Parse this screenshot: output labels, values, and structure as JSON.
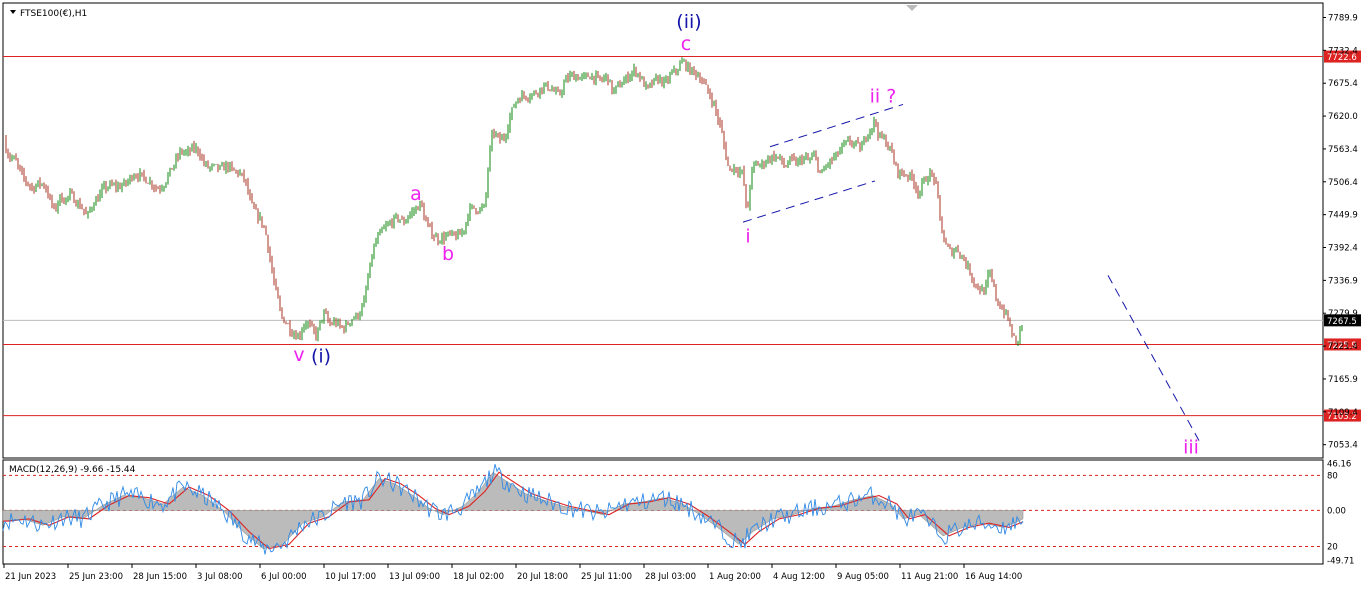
{
  "chart_data": {
    "type": "candlestick",
    "symbol_label": "FTSE100(€),H1",
    "main_panel": {
      "ylim": [
        7030,
        7815
      ],
      "y_ticks": [
        "7789.9",
        "7732.4",
        "7675.4",
        "7620.0",
        "7563.4",
        "7506.4",
        "7449.9",
        "7392.4",
        "7336.9",
        "7279.9",
        "7221.4",
        "7165.9",
        "7109.4",
        "7053.4"
      ],
      "price_series": [
        [
          0,
          7580
        ],
        [
          6,
          7550
        ],
        [
          12,
          7545
        ],
        [
          18,
          7520
        ],
        [
          24,
          7505
        ],
        [
          30,
          7495
        ],
        [
          36,
          7505
        ],
        [
          42,
          7500
        ],
        [
          48,
          7470
        ],
        [
          52,
          7455
        ],
        [
          56,
          7480
        ],
        [
          62,
          7475
        ],
        [
          68,
          7485
        ],
        [
          74,
          7470
        ],
        [
          80,
          7460
        ],
        [
          84,
          7445
        ],
        [
          90,
          7470
        ],
        [
          96,
          7480
        ],
        [
          100,
          7495
        ],
        [
          108,
          7500
        ],
        [
          116,
          7498
        ],
        [
          124,
          7505
        ],
        [
          130,
          7520
        ],
        [
          136,
          7518
        ],
        [
          142,
          7512
        ],
        [
          148,
          7505
        ],
        [
          154,
          7495
        ],
        [
          160,
          7500
        ],
        [
          166,
          7520
        ],
        [
          172,
          7540
        ],
        [
          178,
          7560
        ],
        [
          184,
          7555
        ],
        [
          190,
          7565
        ],
        [
          196,
          7560
        ],
        [
          200,
          7540
        ],
        [
          206,
          7530
        ],
        [
          212,
          7532
        ],
        [
          218,
          7528
        ],
        [
          224,
          7535
        ],
        [
          230,
          7525
        ],
        [
          236,
          7522
        ],
        [
          242,
          7510
        ],
        [
          246,
          7480
        ],
        [
          250,
          7460
        ],
        [
          256,
          7445
        ],
        [
          262,
          7425
        ],
        [
          266,
          7385
        ],
        [
          270,
          7340
        ],
        [
          274,
          7310
        ],
        [
          278,
          7275
        ],
        [
          284,
          7262
        ],
        [
          290,
          7245
        ],
        [
          296,
          7240
        ],
        [
          302,
          7265
        ],
        [
          308,
          7255
        ],
        [
          314,
          7240
        ],
        [
          318,
          7270
        ],
        [
          322,
          7280
        ],
        [
          326,
          7260
        ],
        [
          332,
          7265
        ],
        [
          338,
          7255
        ],
        [
          342,
          7255
        ],
        [
          348,
          7270
        ],
        [
          354,
          7275
        ],
        [
          360,
          7290
        ],
        [
          364,
          7330
        ],
        [
          368,
          7370
        ],
        [
          372,
          7400
        ],
        [
          378,
          7420
        ],
        [
          384,
          7430
        ],
        [
          390,
          7440
        ],
        [
          396,
          7445
        ],
        [
          400,
          7435
        ],
        [
          406,
          7450
        ],
        [
          410,
          7455
        ],
        [
          414,
          7462
        ],
        [
          418,
          7470
        ],
        [
          422,
          7440
        ],
        [
          428,
          7420
        ],
        [
          434,
          7408
        ],
        [
          440,
          7410
        ],
        [
          446,
          7415
        ],
        [
          452,
          7412
        ],
        [
          458,
          7416
        ],
        [
          462,
          7430
        ],
        [
          466,
          7458
        ],
        [
          470,
          7462
        ],
        [
          476,
          7458
        ],
        [
          482,
          7463
        ],
        [
          486,
          7550
        ],
        [
          490,
          7595
        ],
        [
          496,
          7578
        ],
        [
          502,
          7585
        ],
        [
          508,
          7625
        ],
        [
          514,
          7650
        ],
        [
          520,
          7655
        ],
        [
          526,
          7655
        ],
        [
          532,
          7660
        ],
        [
          538,
          7668
        ],
        [
          544,
          7672
        ],
        [
          550,
          7664
        ],
        [
          556,
          7655
        ],
        [
          562,
          7680
        ],
        [
          568,
          7690
        ],
        [
          574,
          7688
        ],
        [
          580,
          7685
        ],
        [
          586,
          7690
        ],
        [
          592,
          7686
        ],
        [
          598,
          7681
        ],
        [
          604,
          7690
        ],
        [
          610,
          7660
        ],
        [
          614,
          7670
        ],
        [
          620,
          7678
        ],
        [
          626,
          7690
        ],
        [
          632,
          7700
        ],
        [
          638,
          7685
        ],
        [
          644,
          7665
        ],
        [
          650,
          7678
        ],
        [
          656,
          7685
        ],
        [
          662,
          7675
        ],
        [
          668,
          7692
        ],
        [
          674,
          7700
        ],
        [
          680,
          7715
        ],
        [
          686,
          7700
        ],
        [
          692,
          7695
        ],
        [
          698,
          7685
        ],
        [
          704,
          7665
        ],
        [
          710,
          7645
        ],
        [
          714,
          7620
        ],
        [
          718,
          7598
        ],
        [
          722,
          7560
        ],
        [
          726,
          7525
        ],
        [
          730,
          7532
        ],
        [
          736,
          7526
        ],
        [
          740,
          7520
        ],
        [
          744,
          7445
        ],
        [
          748,
          7520
        ],
        [
          752,
          7538
        ],
        [
          758,
          7535
        ],
        [
          764,
          7545
        ],
        [
          770,
          7550
        ],
        [
          776,
          7548
        ],
        [
          782,
          7532
        ],
        [
          788,
          7545
        ],
        [
          794,
          7538
        ],
        [
          800,
          7548
        ],
        [
          806,
          7543
        ],
        [
          812,
          7552
        ],
        [
          818,
          7515
        ],
        [
          822,
          7532
        ],
        [
          828,
          7543
        ],
        [
          834,
          7553
        ],
        [
          840,
          7568
        ],
        [
          846,
          7576
        ],
        [
          852,
          7572
        ],
        [
          858,
          7563
        ],
        [
          864,
          7590
        ],
        [
          868,
          7600
        ],
        [
          872,
          7612
        ],
        [
          876,
          7585
        ],
        [
          882,
          7578
        ],
        [
          888,
          7560
        ],
        [
          894,
          7525
        ],
        [
          900,
          7520
        ],
        [
          906,
          7518
        ],
        [
          910,
          7510
        ],
        [
          916,
          7485
        ],
        [
          920,
          7505
        ],
        [
          924,
          7515
        ],
        [
          930,
          7520
        ],
        [
          934,
          7490
        ],
        [
          938,
          7430
        ],
        [
          942,
          7398
        ],
        [
          948,
          7385
        ],
        [
          954,
          7392
        ],
        [
          960,
          7375
        ],
        [
          966,
          7355
        ],
        [
          972,
          7330
        ],
        [
          978,
          7320
        ],
        [
          982,
          7318
        ],
        [
          986,
          7350
        ],
        [
          990,
          7330
        ],
        [
          994,
          7300
        ],
        [
          998,
          7290
        ],
        [
          1004,
          7275
        ],
        [
          1008,
          7250
        ],
        [
          1012,
          7232
        ],
        [
          1014,
          7220
        ],
        [
          1016,
          7250
        ],
        [
          1020,
          7262
        ]
      ],
      "horizontal_levels": [
        {
          "value": 7722.6,
          "label": "7722.6",
          "color": "#dd2222"
        },
        {
          "value": 7225.9,
          "label": "7225.9",
          "color": "#dd2222"
        },
        {
          "value": 7103.2,
          "label": "7103.2",
          "color": "#dd2222"
        },
        {
          "value": 7267.5,
          "label": "7267.5",
          "color": "#bbbbbb"
        }
      ],
      "current_price_label": "7267.5",
      "wave_labels": [
        {
          "text": "(ii)",
          "index": 686,
          "price": 7772,
          "color": "#1515aa"
        },
        {
          "text": "c",
          "index": 683,
          "price": 7734,
          "color": "#ee22ee"
        },
        {
          "text": "a",
          "index": 413,
          "price": 7475,
          "color": "#ee22ee"
        },
        {
          "text": "b",
          "index": 445,
          "price": 7372,
          "color": "#ee22ee"
        },
        {
          "text": "v",
          "index": 296,
          "price": 7197,
          "color": "#ee22ee"
        },
        {
          "text": "(i)",
          "index": 318,
          "price": 7195,
          "color": "#1515aa"
        },
        {
          "text": "ii ?",
          "index": 880,
          "price": 7643,
          "color": "#ee22ee"
        },
        {
          "text": "i",
          "index": 745,
          "price": 7402,
          "color": "#ee22ee"
        },
        {
          "text": "iii",
          "index": 1188,
          "price": 7038,
          "color": "#ee22ee"
        }
      ],
      "channel_lines": [
        {
          "from": [
            740,
            7437
          ],
          "to": [
            872,
            7508
          ],
          "color": "#1515aa",
          "dash": true
        },
        {
          "from": [
            767,
            7567
          ],
          "to": [
            900,
            7640
          ],
          "color": "#1515aa",
          "dash": true
        },
        {
          "from": [
            1105,
            7345
          ],
          "to": [
            1196,
            7060
          ],
          "color": "#1515aa",
          "dash": true
        }
      ]
    },
    "macd_panel": {
      "title": "MACD(12,26,9) -9.66 -15.44",
      "ylim": [
        -50.5,
        47.5
      ],
      "y_ticks": [
        "46.16",
        "80",
        "0.00",
        "20",
        "-49.71"
      ],
      "reference_lines": [
        "80",
        "0.00",
        "20"
      ],
      "histogram_and_signal": [
        [
          0,
          -10
        ],
        [
          20,
          -8
        ],
        [
          40,
          -14
        ],
        [
          60,
          -6
        ],
        [
          80,
          -8
        ],
        [
          100,
          5
        ],
        [
          120,
          14
        ],
        [
          140,
          12
        ],
        [
          160,
          6
        ],
        [
          180,
          22
        ],
        [
          200,
          14
        ],
        [
          220,
          0
        ],
        [
          240,
          -20
        ],
        [
          260,
          -36
        ],
        [
          280,
          -32
        ],
        [
          300,
          -12
        ],
        [
          320,
          -6
        ],
        [
          340,
          8
        ],
        [
          360,
          10
        ],
        [
          376,
          30
        ],
        [
          392,
          25
        ],
        [
          410,
          14
        ],
        [
          426,
          2
        ],
        [
          440,
          -4
        ],
        [
          460,
          4
        ],
        [
          476,
          18
        ],
        [
          490,
          36
        ],
        [
          506,
          26
        ],
        [
          522,
          16
        ],
        [
          540,
          10
        ],
        [
          560,
          4
        ],
        [
          580,
          0
        ],
        [
          600,
          -4
        ],
        [
          620,
          6
        ],
        [
          640,
          8
        ],
        [
          660,
          12
        ],
        [
          680,
          6
        ],
        [
          700,
          -6
        ],
        [
          720,
          -20
        ],
        [
          736,
          -32
        ],
        [
          750,
          -20
        ],
        [
          770,
          -8
        ],
        [
          790,
          -4
        ],
        [
          810,
          2
        ],
        [
          830,
          4
        ],
        [
          850,
          10
        ],
        [
          870,
          14
        ],
        [
          888,
          6
        ],
        [
          900,
          -8
        ],
        [
          916,
          -4
        ],
        [
          940,
          -24
        ],
        [
          960,
          -16
        ],
        [
          980,
          -12
        ],
        [
          1000,
          -16
        ],
        [
          1016,
          -10
        ],
        [
          1020,
          -8
        ]
      ]
    },
    "x_ticks": [
      "21 Jun 2023",
      "25 Jun 23:00",
      "28 Jun 15:00",
      "3 Jul 08:00",
      "6 Jul 00:00",
      "10 Jul 17:00",
      "13 Jul 09:00",
      "18 Jul 02:00",
      "20 Jul 18:00",
      "25 Jul 11:00",
      "28 Jul 03:00",
      "1 Aug 20:00",
      "4 Aug 12:00",
      "9 Aug 05:00",
      "11 Aug 21:00",
      "16 Aug 14:00"
    ],
    "colors": {
      "bull": "#118811",
      "bear": "#aa3322",
      "histogram": "#bbbbbb",
      "macd_line": "#2f8ae6",
      "signal_line": "#dd2222",
      "grid": "#dd2222"
    }
  }
}
